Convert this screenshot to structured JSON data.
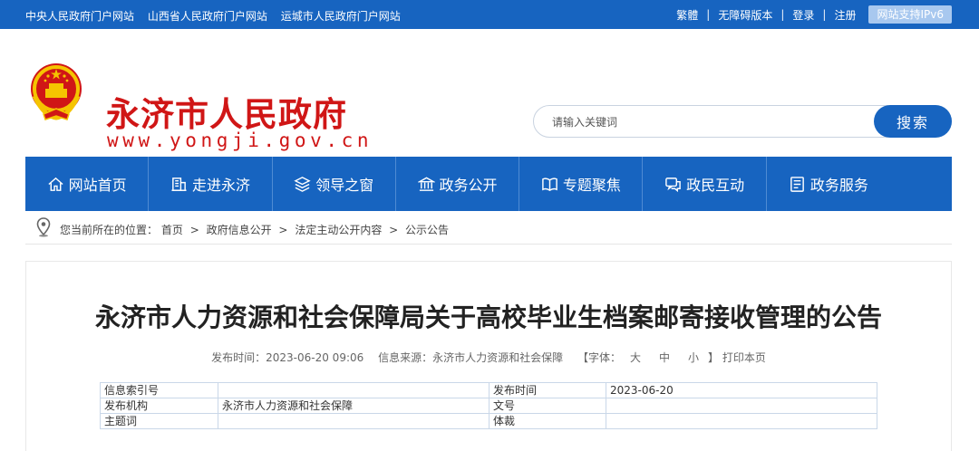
{
  "topbar": {
    "links": [
      "中央人民政府门户网站",
      "山西省人民政府门户网站",
      "运城市人民政府门户网站"
    ],
    "right": {
      "traditional": "繁體",
      "accessible": "无障碍版本",
      "login": "登录",
      "register": "注册",
      "sep": "|",
      "ipv6": "网站支持IPv6"
    }
  },
  "header": {
    "title": "永济市人民政府",
    "url": "www.yongji.gov.cn",
    "search_placeholder": "请输入关键词",
    "search_button": "搜索"
  },
  "nav": [
    {
      "label": "网站首页",
      "icon": "home-icon"
    },
    {
      "label": "走进永济",
      "icon": "building-icon"
    },
    {
      "label": "领导之窗",
      "icon": "layers-icon"
    },
    {
      "label": "政务公开",
      "icon": "bank-icon"
    },
    {
      "label": "专题聚焦",
      "icon": "book-icon"
    },
    {
      "label": "政民互动",
      "icon": "chat-icon"
    },
    {
      "label": "政务服务",
      "icon": "list-icon"
    }
  ],
  "breadcrumb": {
    "prefix": "您当前所在的位置：",
    "items": [
      "首页",
      "政府信息公开",
      "法定主动公开内容",
      "公示公告"
    ],
    "separator": ">"
  },
  "article": {
    "title": "永济市人力资源和社会保障局关于高校毕业生档案邮寄接收管理的公告",
    "publish_time_label": "发布时间：",
    "publish_time": "2023-06-20 09:06",
    "source_label": "信息来源：",
    "source": "永济市人力资源和社会保障",
    "font_label": "【字体：",
    "font_sizes": [
      "大",
      "中",
      "小"
    ],
    "font_close": "】",
    "print": "打印本页"
  },
  "info_table": {
    "rows": [
      {
        "label1": "信息索引号",
        "value1": "",
        "label2": "发布时间",
        "value2": "2023-06-20"
      },
      {
        "label1": "发布机构",
        "value1": "永济市人力资源和社会保障",
        "label2": "文号",
        "value2": ""
      },
      {
        "label1": "主题词",
        "value1": "",
        "label2": "体裁",
        "value2": ""
      }
    ]
  },
  "colors": {
    "primary": "#1764c0",
    "brand_red": "#d01616"
  }
}
